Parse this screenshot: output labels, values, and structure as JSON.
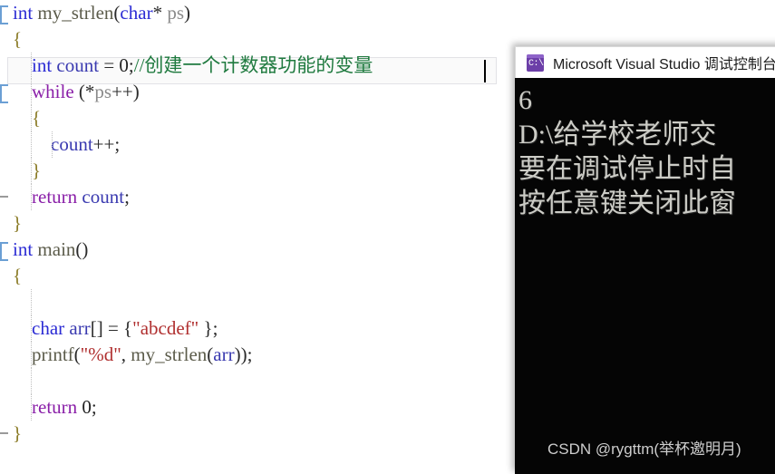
{
  "editor": {
    "name": "visual-studio-code-editor",
    "background": "#ffffff",
    "current_line_index": 2,
    "colors": {
      "keyword": "#2b2bd4",
      "control_keyword": "#8a1fa8",
      "comment": "#1f7a3f",
      "string": "#b03030",
      "brace": "#8a7a25",
      "identifier": "#4a4a5e",
      "caret": "#000000"
    },
    "lines": [
      {
        "id": "line-1",
        "indent": 0,
        "collapse": "bracket",
        "tokens": [
          {
            "t": "int",
            "c": "kw-blue"
          },
          {
            "t": " ",
            "c": "plain"
          },
          {
            "t": "my_strlen",
            "c": "ident-fn"
          },
          {
            "t": "(",
            "c": "plain"
          },
          {
            "t": "char",
            "c": "kw-blue"
          },
          {
            "t": "* ",
            "c": "plain"
          },
          {
            "t": "ps",
            "c": "ident-var"
          },
          {
            "t": ")",
            "c": "plain"
          }
        ]
      },
      {
        "id": "line-2",
        "indent": 0,
        "collapse": "none",
        "tokens": [
          {
            "t": "{",
            "c": "brace"
          }
        ]
      },
      {
        "id": "line-3",
        "indent": 1,
        "collapse": "none",
        "tokens": [
          {
            "t": "    ",
            "c": "plain"
          },
          {
            "t": "int",
            "c": "kw-blue"
          },
          {
            "t": " ",
            "c": "plain"
          },
          {
            "t": "count",
            "c": "localvar"
          },
          {
            "t": " = ",
            "c": "plain"
          },
          {
            "t": "0",
            "c": "num"
          },
          {
            "t": ";",
            "c": "plain"
          },
          {
            "t": "//创建一个计数器功能的变量",
            "c": "comment"
          }
        ]
      },
      {
        "id": "line-4",
        "indent": 1,
        "collapse": "bracket",
        "tokens": [
          {
            "t": "    ",
            "c": "plain"
          },
          {
            "t": "while",
            "c": "kw-purple"
          },
          {
            "t": " (*",
            "c": "plain"
          },
          {
            "t": "ps",
            "c": "ident-var"
          },
          {
            "t": "++)",
            "c": "plain"
          }
        ]
      },
      {
        "id": "line-5",
        "indent": 1,
        "collapse": "none",
        "tokens": [
          {
            "t": "    ",
            "c": "plain"
          },
          {
            "t": "{",
            "c": "brace"
          }
        ]
      },
      {
        "id": "line-6",
        "indent": 2,
        "collapse": "none",
        "tokens": [
          {
            "t": "        ",
            "c": "plain"
          },
          {
            "t": "count",
            "c": "localvar"
          },
          {
            "t": "++;",
            "c": "plain"
          }
        ]
      },
      {
        "id": "line-7",
        "indent": 1,
        "collapse": "none",
        "tokens": [
          {
            "t": "    ",
            "c": "plain"
          },
          {
            "t": "}",
            "c": "brace"
          }
        ]
      },
      {
        "id": "line-8",
        "indent": 1,
        "collapse": "dash",
        "tokens": [
          {
            "t": "    ",
            "c": "plain"
          },
          {
            "t": "return",
            "c": "kw-purple"
          },
          {
            "t": " ",
            "c": "plain"
          },
          {
            "t": "count",
            "c": "localvar"
          },
          {
            "t": ";",
            "c": "plain"
          }
        ]
      },
      {
        "id": "line-9",
        "indent": 0,
        "collapse": "none",
        "tokens": [
          {
            "t": "}",
            "c": "brace"
          }
        ]
      },
      {
        "id": "line-10",
        "indent": 0,
        "collapse": "bracket",
        "tokens": [
          {
            "t": "int",
            "c": "kw-blue"
          },
          {
            "t": " ",
            "c": "plain"
          },
          {
            "t": "main",
            "c": "ident-fn"
          },
          {
            "t": "()",
            "c": "plain"
          }
        ]
      },
      {
        "id": "line-11",
        "indent": 0,
        "collapse": "none",
        "tokens": [
          {
            "t": "{",
            "c": "brace"
          }
        ]
      },
      {
        "id": "line-12",
        "indent": 1,
        "collapse": "none",
        "tokens": []
      },
      {
        "id": "line-13",
        "indent": 1,
        "collapse": "none",
        "tokens": [
          {
            "t": "    ",
            "c": "plain"
          },
          {
            "t": "char",
            "c": "kw-blue"
          },
          {
            "t": " ",
            "c": "plain"
          },
          {
            "t": "arr",
            "c": "localvar"
          },
          {
            "t": "[] = {",
            "c": "plain"
          },
          {
            "t": "\"abcdef\"",
            "c": "str"
          },
          {
            "t": " };",
            "c": "plain"
          }
        ]
      },
      {
        "id": "line-14",
        "indent": 1,
        "collapse": "none",
        "tokens": [
          {
            "t": "    ",
            "c": "plain"
          },
          {
            "t": "printf",
            "c": "ident-fn"
          },
          {
            "t": "(",
            "c": "plain"
          },
          {
            "t": "\"%d\"",
            "c": "str"
          },
          {
            "t": ", ",
            "c": "plain"
          },
          {
            "t": "my_strlen",
            "c": "ident-fn"
          },
          {
            "t": "(",
            "c": "plain"
          },
          {
            "t": "arr",
            "c": "localvar"
          },
          {
            "t": "));",
            "c": "plain"
          }
        ]
      },
      {
        "id": "line-15",
        "indent": 1,
        "collapse": "none",
        "tokens": []
      },
      {
        "id": "line-16",
        "indent": 1,
        "collapse": "none",
        "tokens": [
          {
            "t": "    ",
            "c": "plain"
          },
          {
            "t": "return",
            "c": "kw-purple"
          },
          {
            "t": " ",
            "c": "plain"
          },
          {
            "t": "0",
            "c": "num"
          },
          {
            "t": ";",
            "c": "plain"
          }
        ]
      },
      {
        "id": "line-17",
        "indent": 0,
        "collapse": "dash",
        "tokens": [
          {
            "t": "}",
            "c": "brace"
          }
        ]
      }
    ]
  },
  "console": {
    "name": "debug-console-window",
    "title": "Microsoft Visual Studio 调试控制台",
    "icon": "console-icon",
    "icon_prompt": "C:\\",
    "background": "#050505",
    "text_color": "#ccccc6",
    "output_lines": [
      "6",
      "D:\\给学校老师交",
      "要在调试停止时自",
      "按任意键关闭此窗"
    ],
    "watermark": "CSDN @rygttm(举杯邀明月)"
  }
}
